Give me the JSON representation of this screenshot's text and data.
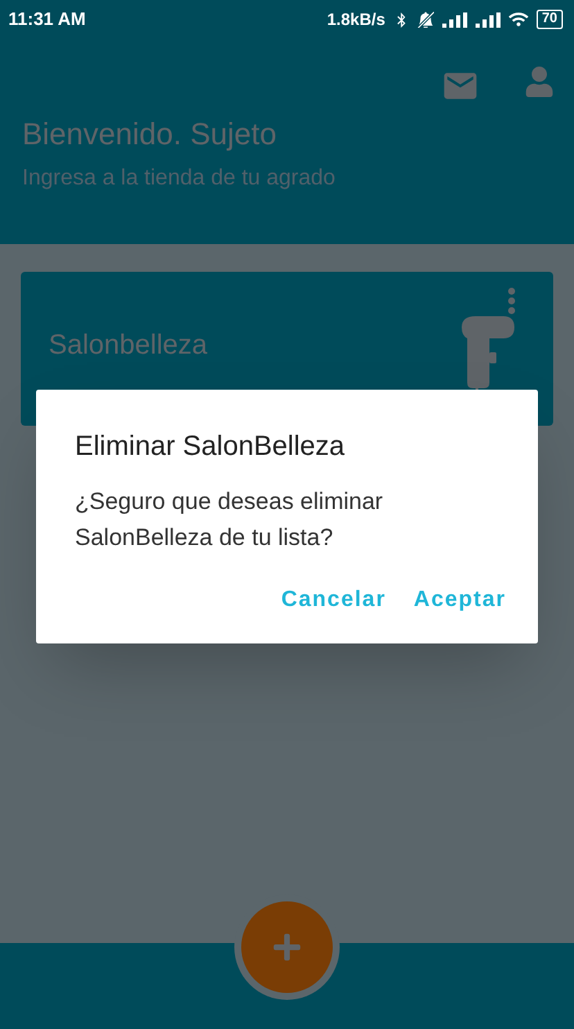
{
  "status_bar": {
    "time": "11:31 AM",
    "speed": "1.8kB/s",
    "battery": "70"
  },
  "header": {
    "title": "Bienvenido. Sujeto",
    "subtitle": "Ingresa a la tienda de tu agrado"
  },
  "stores": [
    {
      "name": "Salonbelleza"
    }
  ],
  "dialog": {
    "title": "Eliminar SalonBelleza",
    "message": "¿Seguro que deseas eliminar SalonBelleza de tu lista?",
    "buttons": [
      "Cancelar",
      "Aceptar"
    ]
  }
}
